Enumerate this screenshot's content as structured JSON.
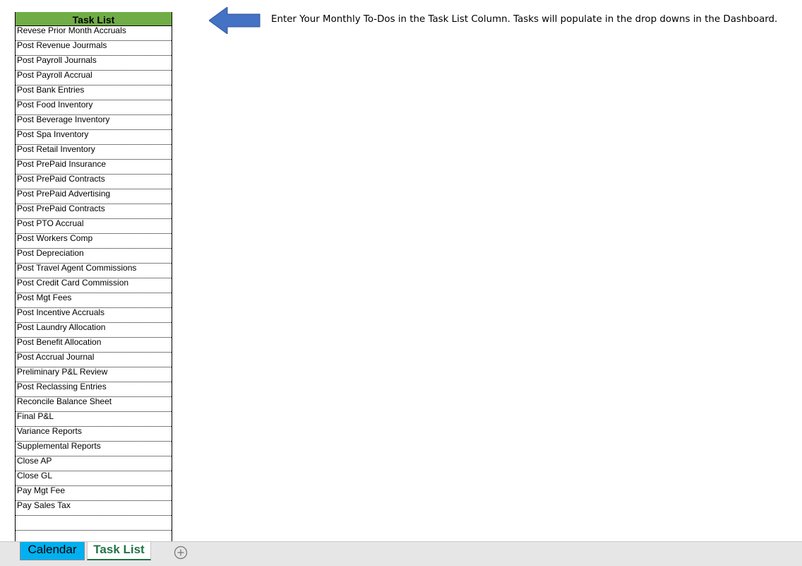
{
  "task_list": {
    "header": "Task List",
    "items": [
      "Revese Prior Month Accruals",
      "Post Revenue Jourmals",
      "Post Payroll Journals",
      "Post Payroll Accrual",
      "Post Bank Entries",
      "Post Food Inventory",
      "Post Beverage Inventory",
      "Post Spa Inventory",
      "Post Retail Inventory",
      "Post PrePaid Insurance",
      "Post PrePaid Contracts",
      "Post PrePaid Advertising",
      "Post PrePaid Contracts",
      "Post PTO Accrual",
      "Post Workers Comp",
      "Post Depreciation",
      "Post Travel Agent Commissions",
      "Post Credit Card Commission",
      "Post Mgt Fees",
      "Post Incentive Accruals",
      "Post Laundry Allocation",
      "Post Benefit Allocation",
      "Post Accrual Journal",
      "Preliminary P&L Review",
      "Post Reclassing Entries",
      "Reconcile Balance Sheet",
      "Final P&L",
      "Variance Reports",
      "Supplemental Reports",
      "Close AP",
      "Close GL",
      "Pay Mgt Fee",
      "Pay Sales Tax",
      "",
      ""
    ]
  },
  "instruction_text": "Enter Your Monthly To-Dos in the Task List Column.   Tasks will populate in the drop downs in the Dashboard.",
  "sheet_tabs": [
    {
      "label": "Calendar",
      "color": "#00b0f0"
    },
    {
      "label": "Task List",
      "active": true,
      "color": "#217346"
    }
  ],
  "colors": {
    "header_fill": "#70ad47",
    "arrow": "#4472c4"
  },
  "icons": {
    "arrow": "left-arrow-icon",
    "add_sheet": "plus-circle-icon"
  }
}
